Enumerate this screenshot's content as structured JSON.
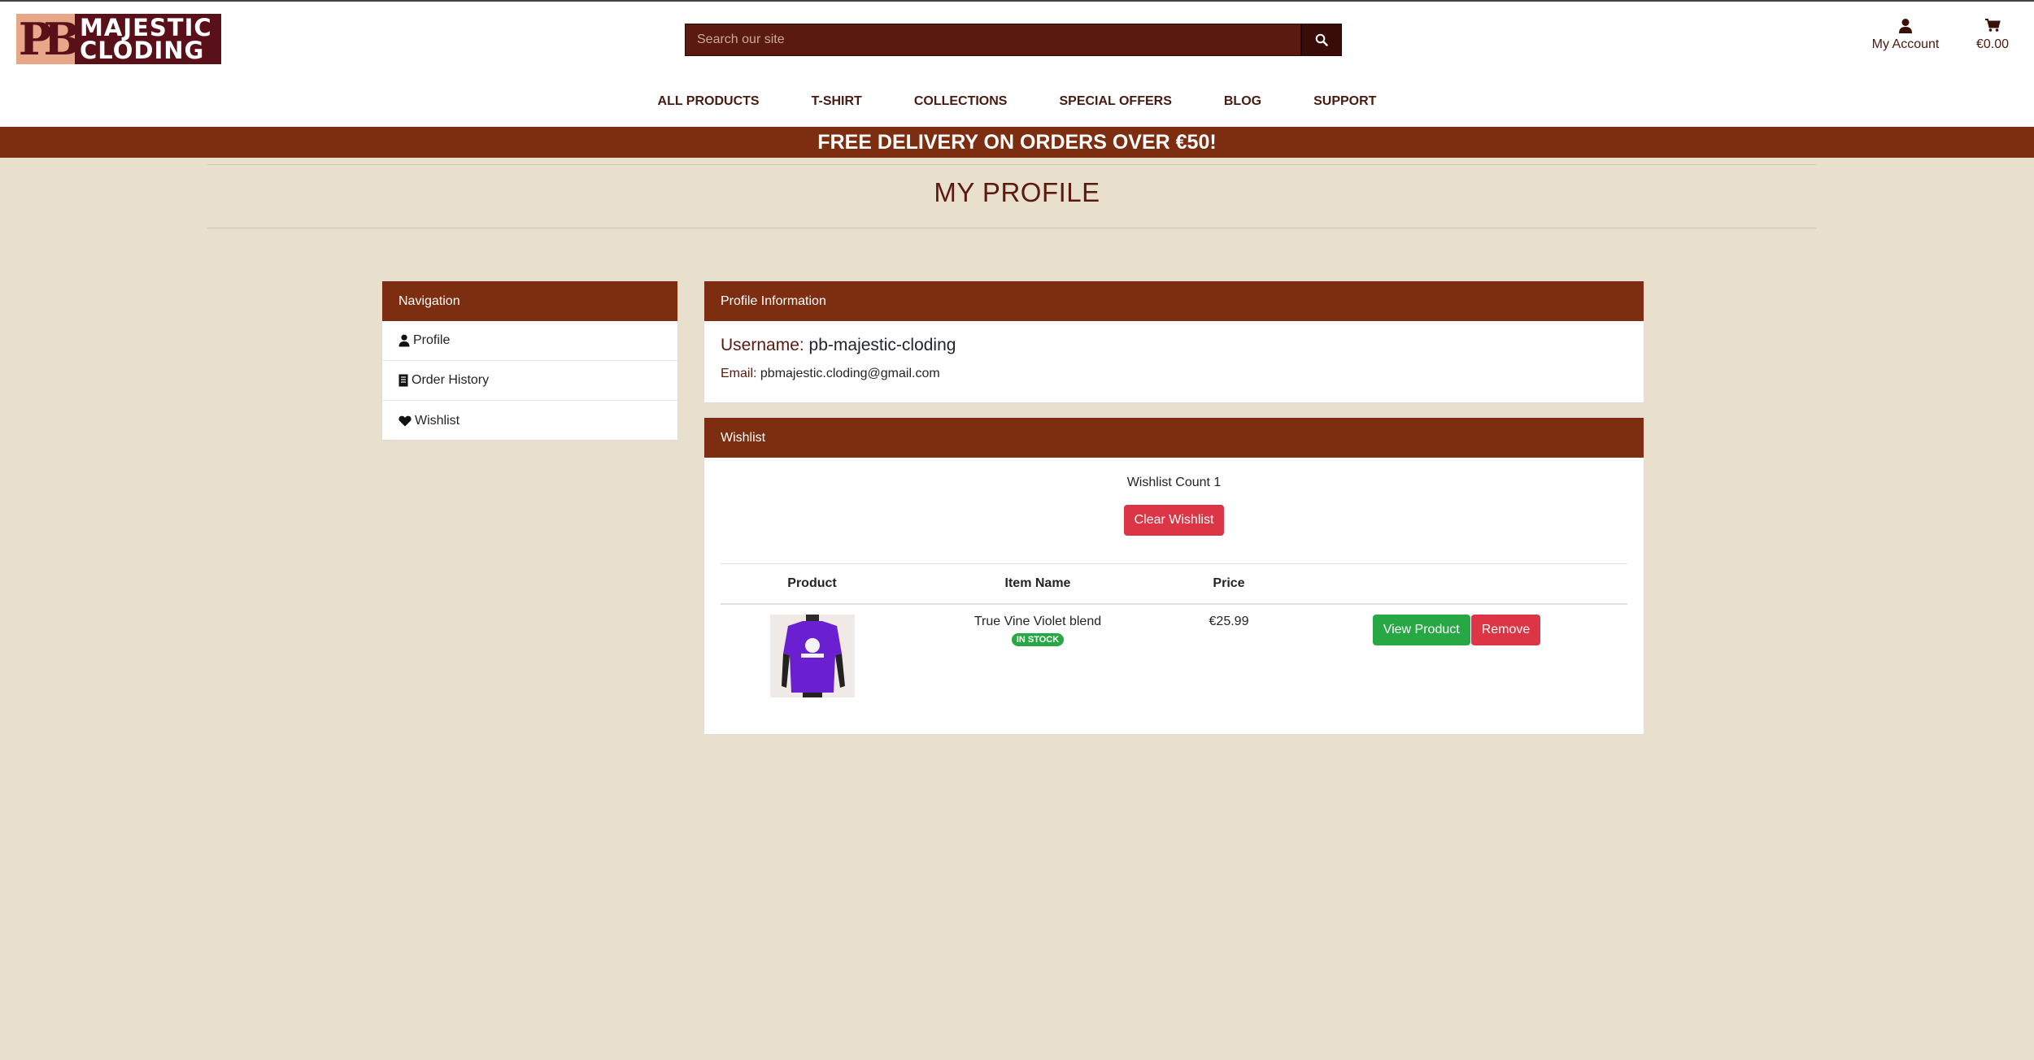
{
  "header": {
    "logo_text_line1": "MAJESTIC",
    "logo_text_line2": "CLODING",
    "logo_mark": "PB",
    "search_placeholder": "Search our site",
    "account_label": "My Account",
    "cart_total": "€0.00",
    "nav": [
      "ALL PRODUCTS",
      "T-SHIRT",
      "COLLECTIONS",
      "SPECIAL OFFERS",
      "BLOG",
      "SUPPORT"
    ]
  },
  "banner": "FREE DELIVERY ON ORDERS OVER €50!",
  "page_title": "MY PROFILE",
  "sidebar": {
    "title": "Navigation",
    "items": [
      {
        "label": "Profile",
        "icon": "user-icon"
      },
      {
        "label": "Order History",
        "icon": "receipt-icon"
      },
      {
        "label": "Wishlist",
        "icon": "heart-icon"
      }
    ]
  },
  "profile": {
    "title": "Profile Information",
    "username_label": "Username:",
    "username": "pb-majestic-cloding",
    "email_label": "Email:",
    "email": "pbmajestic.cloding@gmail.com"
  },
  "wishlist": {
    "title": "Wishlist",
    "count_text": "Wishlist Count 1",
    "clear_label": "Clear Wishlist",
    "columns": [
      "Product",
      "Item Name",
      "Price",
      ""
    ],
    "rows": [
      {
        "item_name": "True Vine Violet blend",
        "stock": "IN STOCK",
        "price": "€25.99",
        "view_label": "View Product",
        "remove_label": "Remove"
      }
    ]
  },
  "colors": {
    "brand": "#7d2d10",
    "dark_brand": "#5a1a10",
    "background": "#e9dfcd",
    "success": "#28a745",
    "danger": "#dc3545"
  }
}
